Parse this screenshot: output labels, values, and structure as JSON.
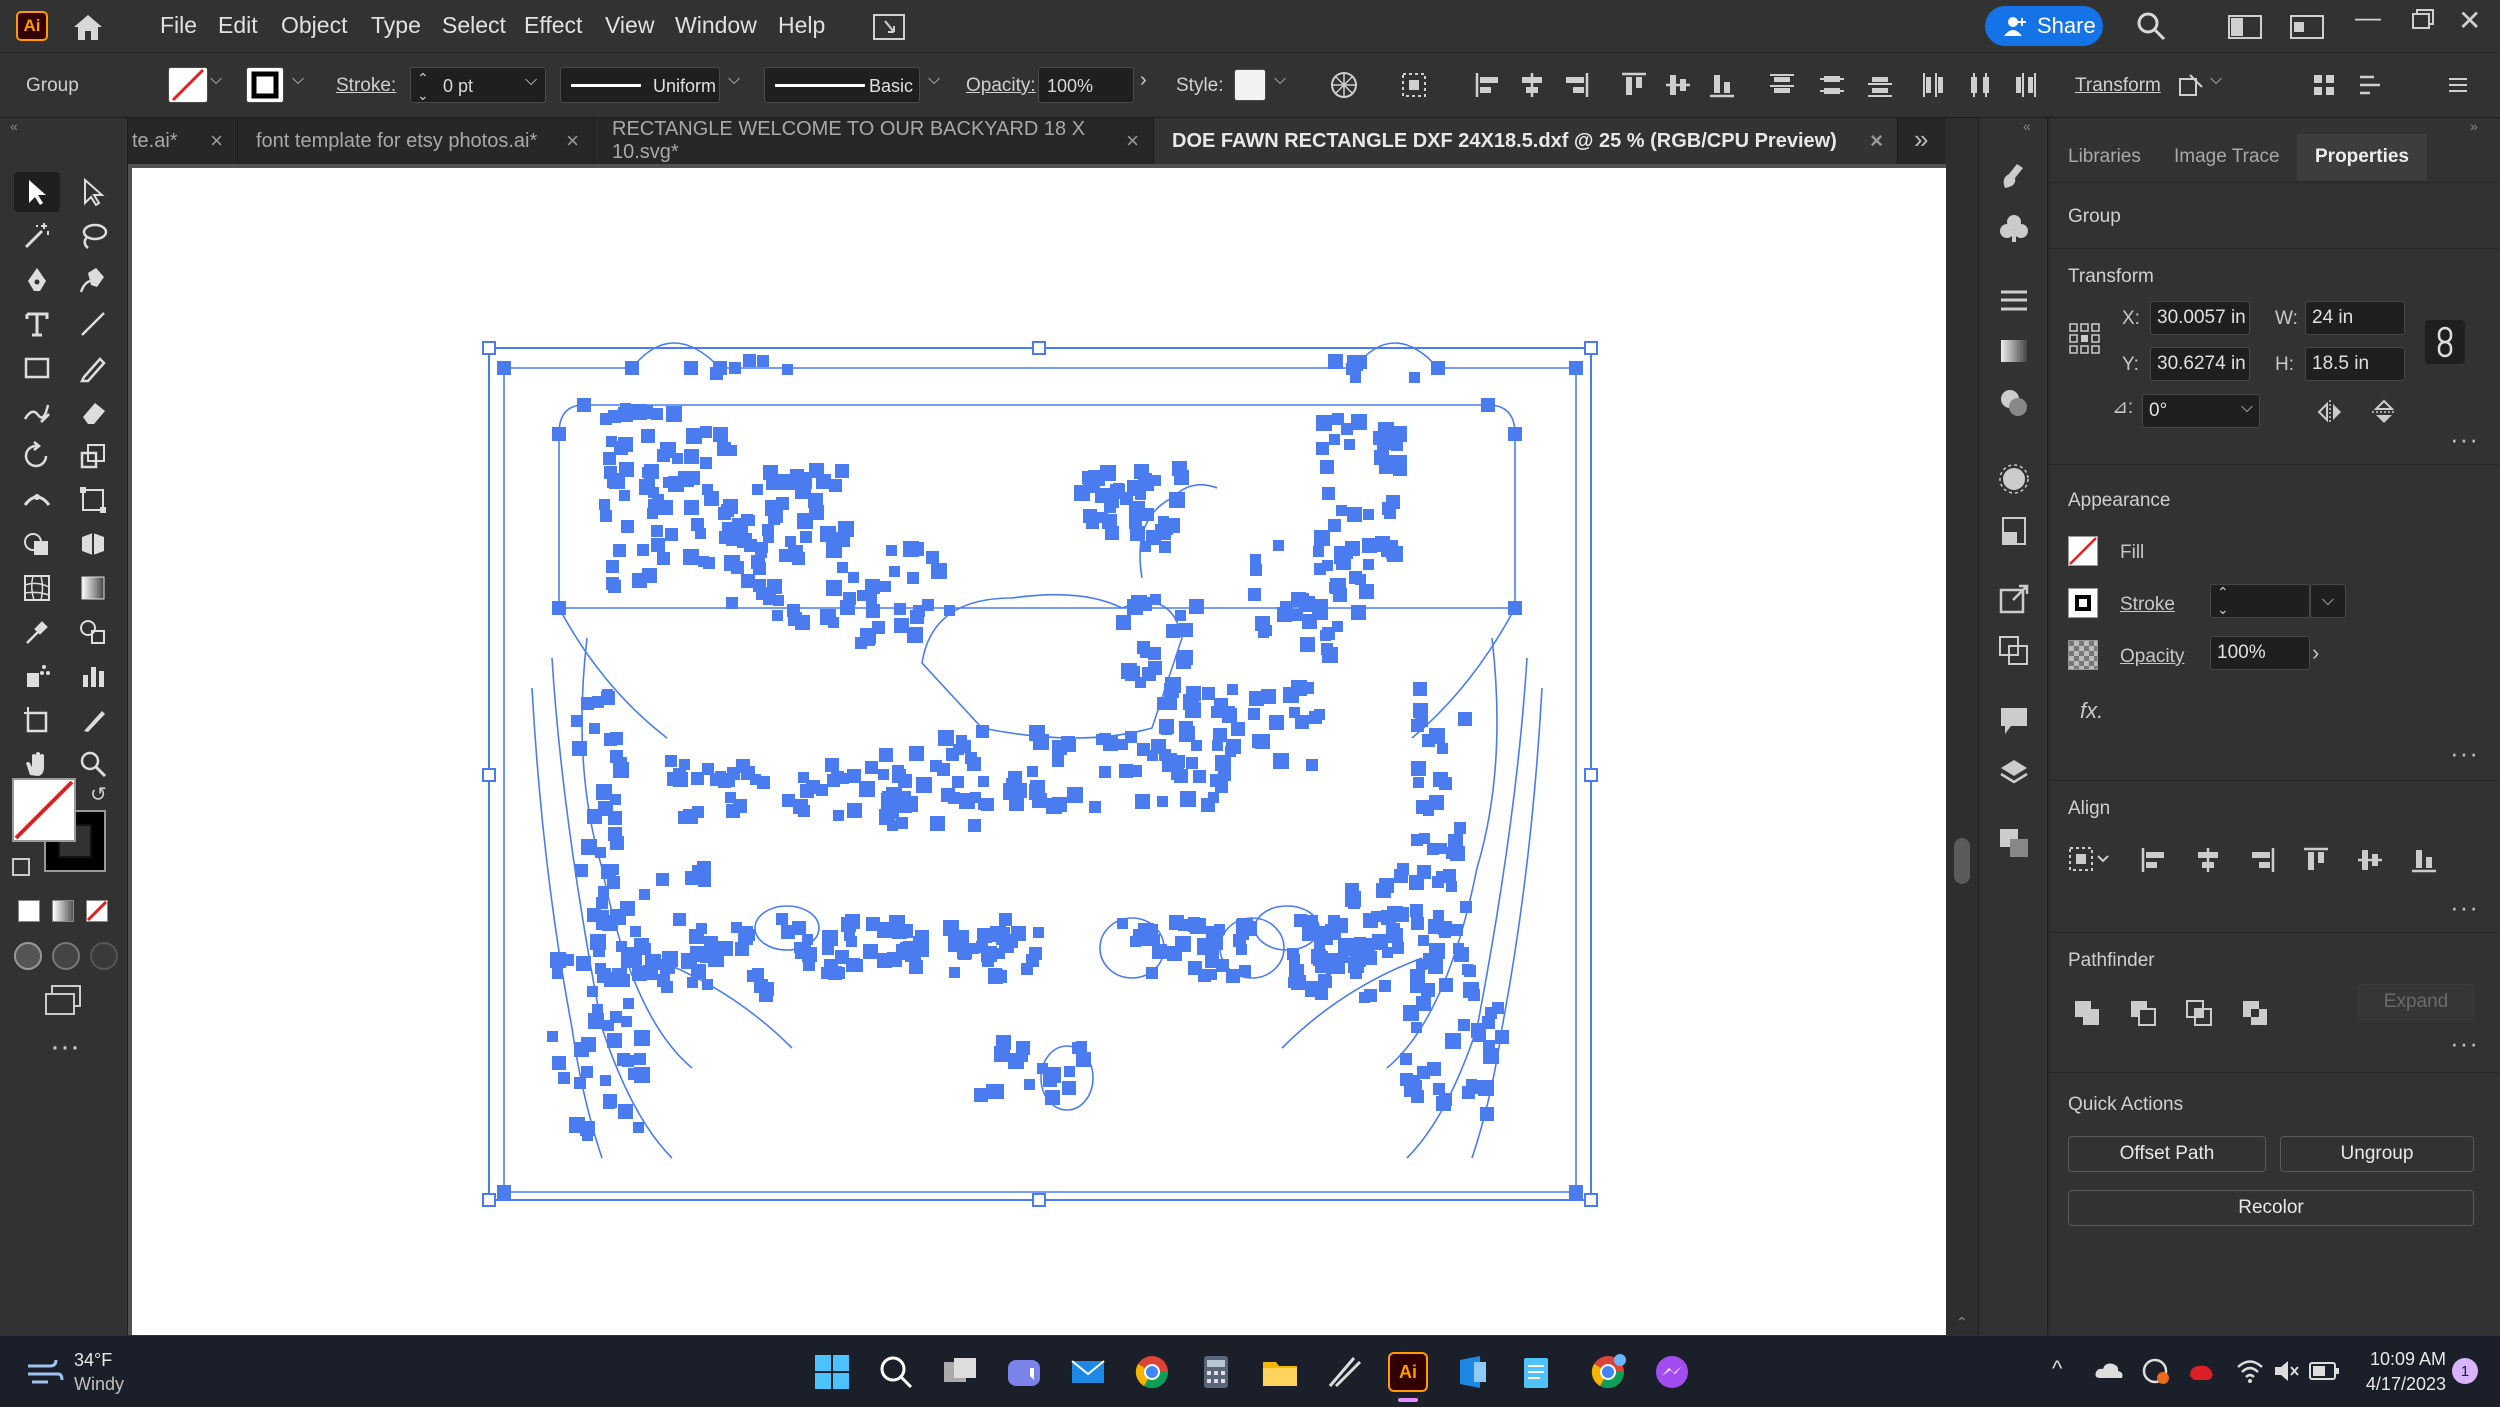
{
  "app": {
    "logo_text": "Ai",
    "accent": "#ff9a00",
    "selection_color": "#4a7cf0"
  },
  "menu": {
    "items": [
      "File",
      "Edit",
      "Object",
      "Type",
      "Select",
      "Effect",
      "View",
      "Window",
      "Help"
    ]
  },
  "topright": {
    "share_label": "Share"
  },
  "controlbar": {
    "selection_type": "Group",
    "stroke_label": "Stroke:",
    "stroke_value": "0 pt",
    "profile_uniform": "Uniform",
    "brush_basic": "Basic",
    "opacity_label": "Opacity:",
    "opacity_value": "100%",
    "style_label": "Style:",
    "transform_label": "Transform"
  },
  "tabs": [
    {
      "label": "te.ai*",
      "active": false
    },
    {
      "label": "font template for etsy photos.ai*",
      "active": false
    },
    {
      "label": "RECTANGLE WELCOME TO OUR BACKYARD 18 X 10.svg*",
      "active": false
    },
    {
      "label": "DOE FAWN RECTANGLE DXF 24X18.5.dxf @ 25 % (RGB/CPU Preview)",
      "active": true
    }
  ],
  "panel": {
    "tabs": [
      "Libraries",
      "Image Trace",
      "Properties"
    ],
    "active_tab": "Properties",
    "group_label": "Group",
    "transform": {
      "title": "Transform",
      "x_label": "X:",
      "x": "30.0057 in",
      "y_label": "Y:",
      "y": "30.6274 in",
      "w_label": "W:",
      "w": "24 in",
      "h_label": "H:",
      "h": "18.5 in",
      "angle": "0°"
    },
    "appearance": {
      "title": "Appearance",
      "fill": "Fill",
      "stroke": "Stroke",
      "opacity_label": "Opacity",
      "opacity": "100%",
      "fx": "fx."
    },
    "align": {
      "title": "Align"
    },
    "pathfinder": {
      "title": "Pathfinder",
      "expand": "Expand"
    },
    "quick_actions": {
      "title": "Quick Actions",
      "offset_path": "Offset Path",
      "ungroup": "Ungroup",
      "recolor": "Recolor"
    }
  },
  "taskbar": {
    "weather_temp": "34°F",
    "weather_desc": "Windy",
    "time": "10:09 AM",
    "date": "4/17/2023",
    "notif_count": "1"
  }
}
